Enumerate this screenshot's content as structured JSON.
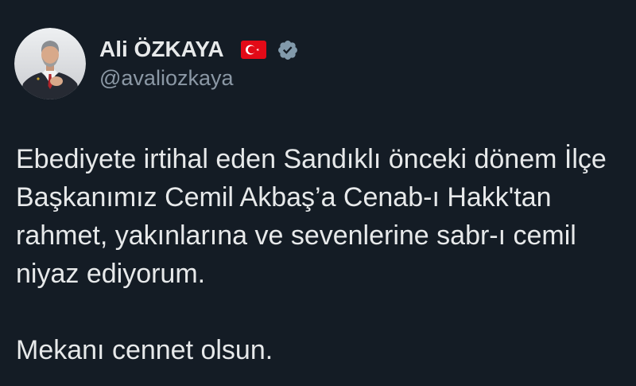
{
  "author": {
    "name": "Ali ÖZKAYA",
    "handle": "@avaliozkaya"
  },
  "icons": {
    "flag": "turkey-flag-icon",
    "verified": "verified-badge-icon",
    "avatar": "profile-photo"
  },
  "tweet": {
    "paragraphs": [
      [
        "Ebediyete irtihal eden Sandıklı önceki dönem İlçe",
        "Başkanımız Cemil Akbaş’a Cenab-ı Hakk'tan",
        "rahmet, yakınlarına ve sevenlerine sabr-ı cemil",
        "niyaz ediyorum."
      ],
      [
        "Mekanı cennet olsun."
      ]
    ]
  },
  "colors": {
    "background": "#141c25",
    "text": "#e7e9ea",
    "muted": "#8b98a5",
    "verified": "#829aab",
    "flag_red": "#e30a17"
  }
}
